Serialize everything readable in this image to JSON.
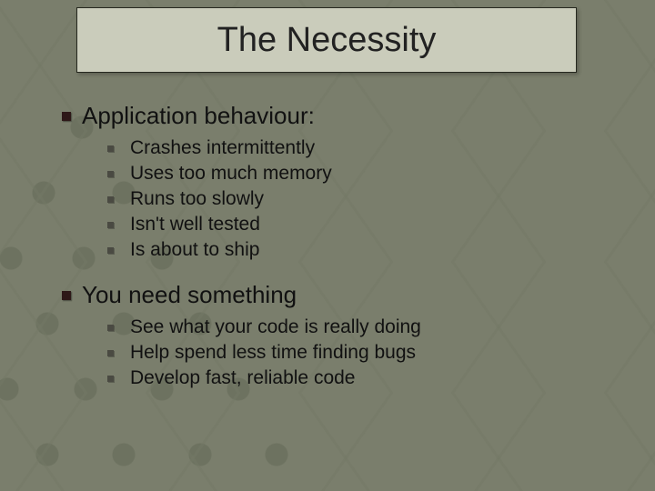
{
  "title": "The Necessity",
  "sections": [
    {
      "heading": "Application behaviour:",
      "items": [
        "Crashes intermittently",
        "Uses too much memory",
        "Runs too slowly",
        "Isn't well tested",
        "Is about to ship"
      ]
    },
    {
      "heading": "You need something",
      "items": [
        "See what your code is really doing",
        "Help spend less time finding bugs",
        "Develop fast, reliable code"
      ]
    }
  ]
}
